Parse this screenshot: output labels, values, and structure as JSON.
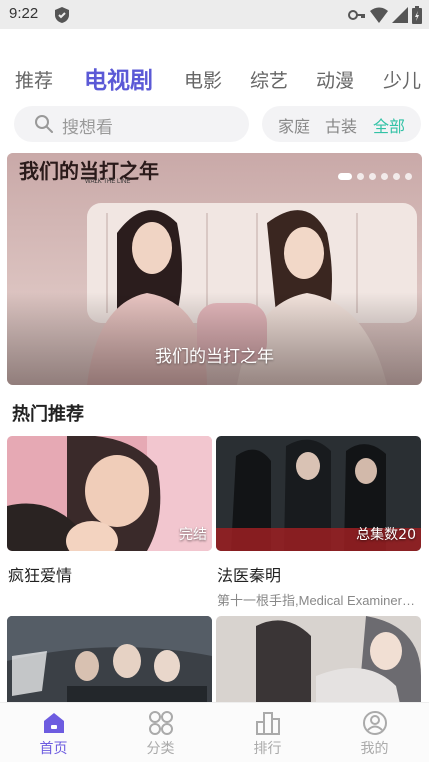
{
  "status_bar": {
    "time": "9:22"
  },
  "tabs": [
    {
      "label": "推荐",
      "active": false
    },
    {
      "label": "电视剧",
      "active": true
    },
    {
      "label": "电影",
      "active": false
    },
    {
      "label": "综艺",
      "active": false
    },
    {
      "label": "动漫",
      "active": false
    },
    {
      "label": "少儿",
      "active": false
    }
  ],
  "search": {
    "placeholder": "搜想看"
  },
  "filters": [
    {
      "label": "家庭",
      "active": false
    },
    {
      "label": "古装",
      "active": false
    },
    {
      "label": "全部",
      "active": true
    }
  ],
  "banner": {
    "caption": "我们的当打之年",
    "logo_text": "我们的当打之年",
    "logo_sub": "WALK THE LINE",
    "slide_count": 6,
    "active_slide": 1
  },
  "section": {
    "title": "热门推荐"
  },
  "cards": [
    {
      "title": "疯狂爱情",
      "badge": "完结",
      "subtitle": ""
    },
    {
      "title": "法医秦明",
      "badge": "总集数20",
      "subtitle": "第十一根手指,Medical Examiner Dr. Qin"
    },
    {
      "title": "",
      "badge": "",
      "subtitle": ""
    },
    {
      "title": "",
      "badge": "",
      "subtitle": ""
    }
  ],
  "bottom_nav": [
    {
      "label": "首页",
      "icon": "home-icon",
      "active": true
    },
    {
      "label": "分类",
      "icon": "category-icon",
      "active": false
    },
    {
      "label": "排行",
      "icon": "ranking-icon",
      "active": false
    },
    {
      "label": "我的",
      "icon": "profile-icon",
      "active": false
    }
  ],
  "colors": {
    "accent": "#5b59d6",
    "filter_active": "#33c2a6",
    "nav_active": "#6d5ce0"
  }
}
